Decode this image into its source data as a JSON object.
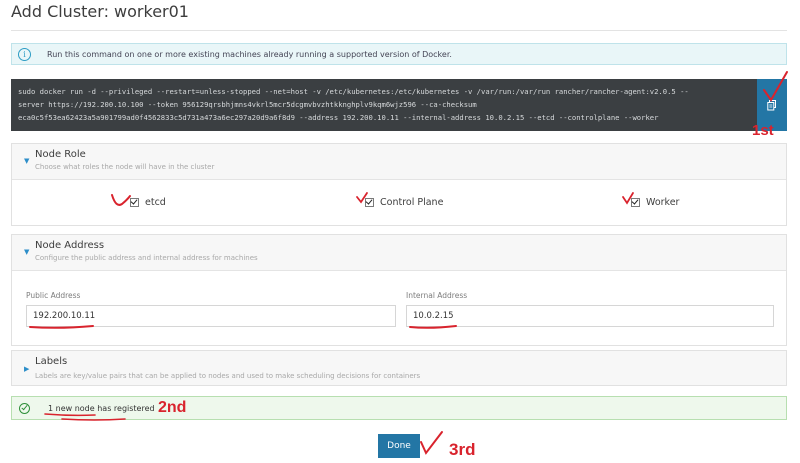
{
  "dialog": {
    "title": "Add Cluster: worker01"
  },
  "info_banner": {
    "text": "Run this command on one or more existing machines already running a supported version of Docker."
  },
  "command": {
    "line1": "sudo docker run -d --privileged --restart=unless-stopped --net=host -v /etc/kubernetes:/etc/kubernetes -v /var/run:/var/run rancher/rancher-agent:v2.0.5 --",
    "line2": "server https://192.200.10.100 --token 956129qrsbhjmns4vkrl5mcr5dcgmvbvzhtkknghplv9kqm6wjz596 --ca-checksum",
    "line3": "eca0c5f53ea62423a5a901799ad0f4562833c5d731a473a6ec297a20d9a6f8d9 --address 192.200.10.11 --internal-address 10.0.2.15 --etcd --controlplane --worker"
  },
  "node_role": {
    "title": "Node Role",
    "description": "Choose what roles the node will have in the cluster",
    "roles": [
      {
        "label": "etcd",
        "checked": true
      },
      {
        "label": "Control Plane",
        "checked": true
      },
      {
        "label": "Worker",
        "checked": true
      }
    ]
  },
  "node_address": {
    "title": "Node Address",
    "description": "Configure the public address and internal address for machines",
    "public_label": "Public Address",
    "public_value": "192.200.10.11",
    "internal_label": "Internal Address",
    "internal_value": "10.0.2.15"
  },
  "labels": {
    "title": "Labels",
    "description": "Labels are key/value pairs that can be applied to nodes and used to make scheduling decisions for containers"
  },
  "status": {
    "text": "1 new node has registered"
  },
  "done_button": {
    "label": "Done"
  },
  "annotations": {
    "first": "1st",
    "second": "2nd",
    "third": "3rd",
    "color": "#d9232d"
  },
  "colors": {
    "primary": "#2376a5",
    "command_bg": "#3b3f42",
    "info_bg": "#e9f6f8",
    "success_bg": "#eef8ec"
  }
}
